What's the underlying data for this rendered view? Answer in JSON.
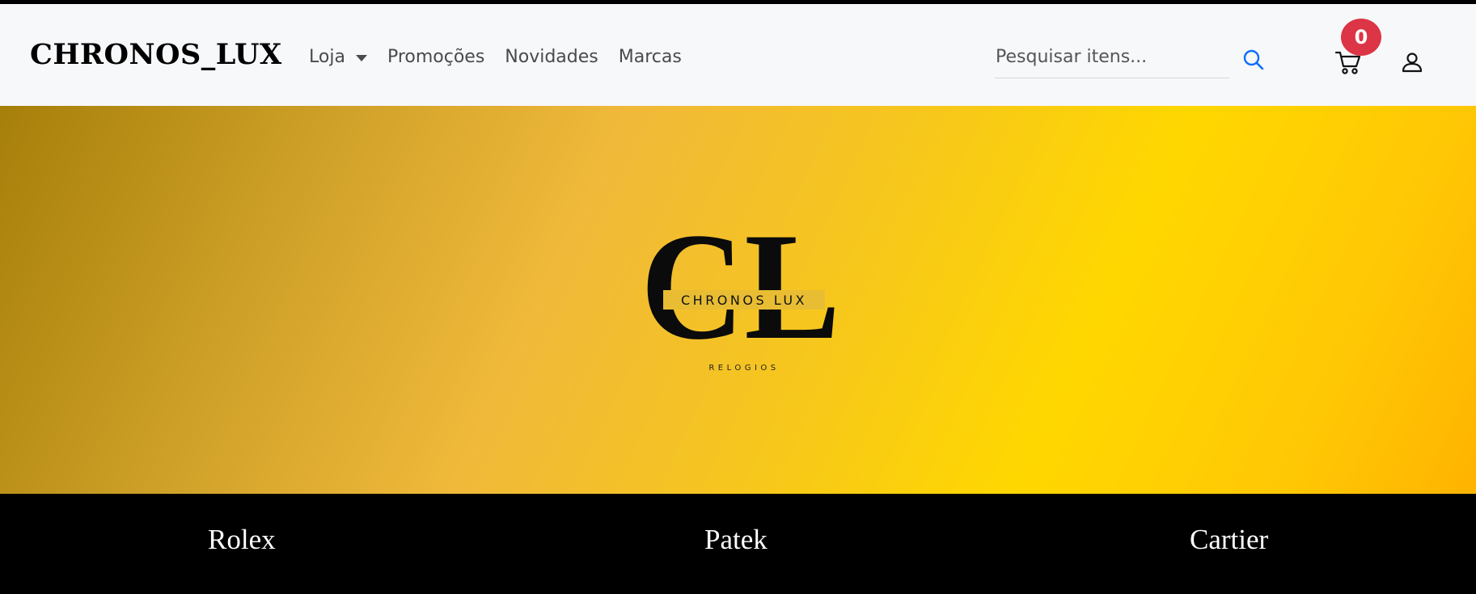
{
  "header": {
    "brand": "CHRONOS_LUX",
    "nav": [
      "Loja",
      "Promoções",
      "Novidades",
      "Marcas"
    ],
    "search": {
      "placeholder": "Pesquisar itens..."
    },
    "cart_count": "0"
  },
  "hero": {
    "logo_letters": "CL",
    "logo_name": "CHRONOS LUX",
    "logo_tagline": "RELOGIOS"
  },
  "brands": [
    "Rolex",
    "Patek",
    "Cartier"
  ],
  "colors": {
    "navbar_bg": "#f7f8fa",
    "accent_blue": "#0d6efd",
    "badge_red": "#dc3545",
    "gold_dark": "#a67f0a",
    "gold_bright": "#ffd700"
  },
  "icons": {
    "search": "search-icon",
    "cart": "cart-icon",
    "user": "user-icon",
    "dropdown": "chevron-down-icon"
  }
}
